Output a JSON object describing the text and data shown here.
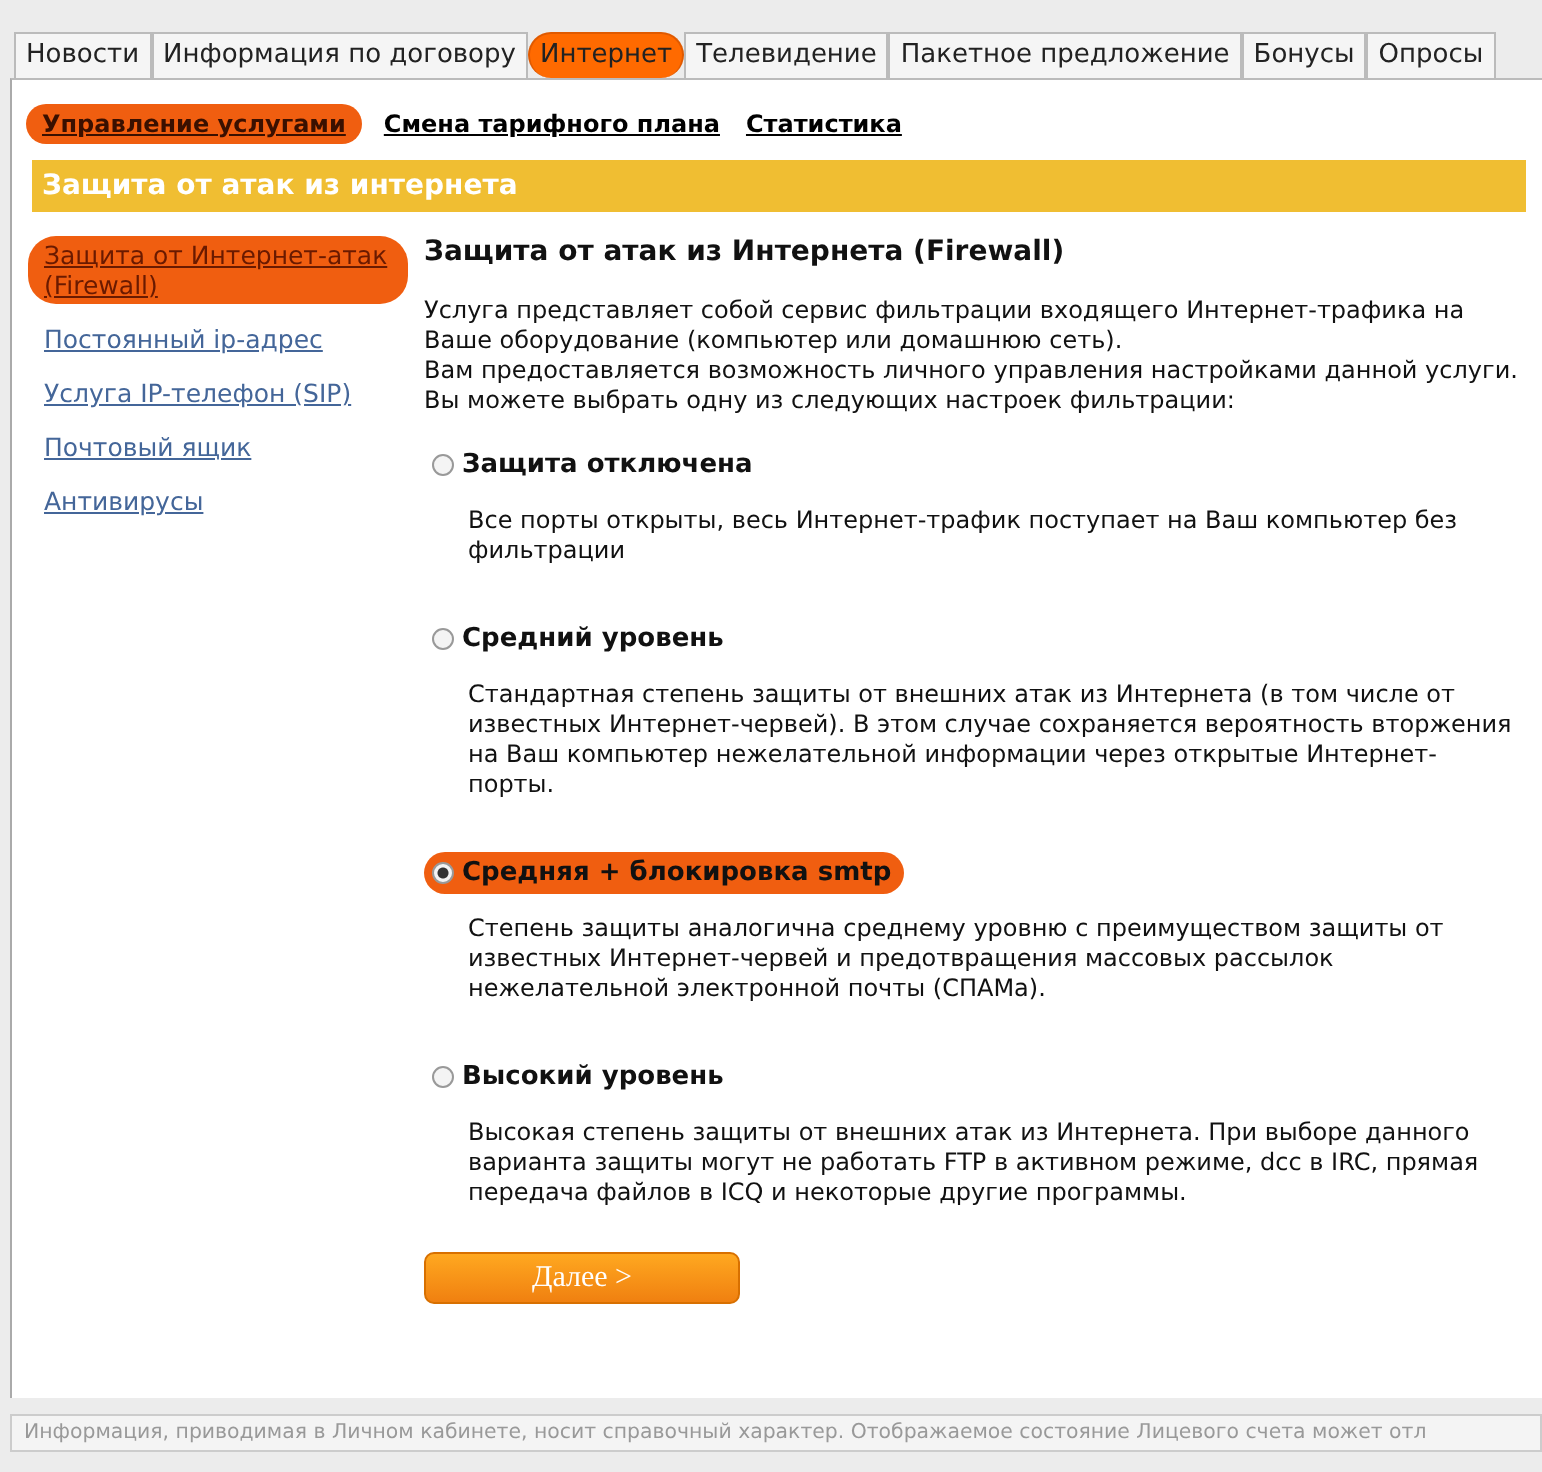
{
  "tabs": [
    {
      "label": "Новости",
      "selected": false
    },
    {
      "label": "Информация по договору",
      "selected": false
    },
    {
      "label": "Интернет",
      "selected": true
    },
    {
      "label": "Телевидение",
      "selected": false
    },
    {
      "label": "Пакетное предложение",
      "selected": false
    },
    {
      "label": "Бонусы",
      "selected": false
    },
    {
      "label": "Опросы",
      "selected": false
    }
  ],
  "subnav": [
    {
      "label": "Управление услугами",
      "selected": true
    },
    {
      "label": "Смена тарифного плана",
      "selected": false
    },
    {
      "label": "Статистика",
      "selected": false
    }
  ],
  "section_title": "Защита от атак из интернета",
  "sidebar": {
    "items": [
      {
        "label": "Защита от Интернет-атак (Firewall)",
        "selected": true
      },
      {
        "label": "Постоянный ip-адрес",
        "selected": false
      },
      {
        "label": "Услуга IP-телефон (SIP)",
        "selected": false
      },
      {
        "label": "Почтовый ящик",
        "selected": false
      },
      {
        "label": "Антивирусы",
        "selected": false
      }
    ]
  },
  "content": {
    "heading": "Защита от атак из Интернета (Firewall)",
    "intro": [
      "Услуга представляет собой сервис фильтрации входящего Интернет-трафика на Ваше оборудование (компьютер или домашнюю сеть).",
      "Вам предоставляется возможность личного управления настройками данной услуги.",
      "Вы можете выбрать одну из следующих настроек фильтрации:"
    ],
    "options": [
      {
        "label": "Защита отключена",
        "selected": false,
        "description": "Все порты открыты, весь Интернет-трафик поступает на Ваш компьютер без фильтрации"
      },
      {
        "label": "Средний уровень",
        "selected": false,
        "description": "Стандартная степень защиты от внешних атак из Интернета (в том числе от известных Интернет-червей). В этом случае сохраняется вероятность вторжения на Ваш компьютер нежелательной информации через открытые Интернет-порты."
      },
      {
        "label": "Средняя + блокировка smtp",
        "selected": true,
        "description": "Степень защиты аналогична среднему уровню с преимуществом защиты от известных Интернет-червей и предотвращения массовых рассылок нежелательной электронной почты (СПАМа)."
      },
      {
        "label": "Высокий уровень",
        "selected": false,
        "description": "Высокая степень защиты от внешних атак из Интернета. При выборе данного варианта защиты могут не работать FTP в активном режиме, dcc в IRC, прямая передача файлов в ICQ и некоторые другие программы."
      }
    ],
    "next_button": "Далее >"
  },
  "footer": "Информация, приводимая в Личном кабинете, носит справочный характер. Отображаемое состояние Лицевого счета может отл"
}
